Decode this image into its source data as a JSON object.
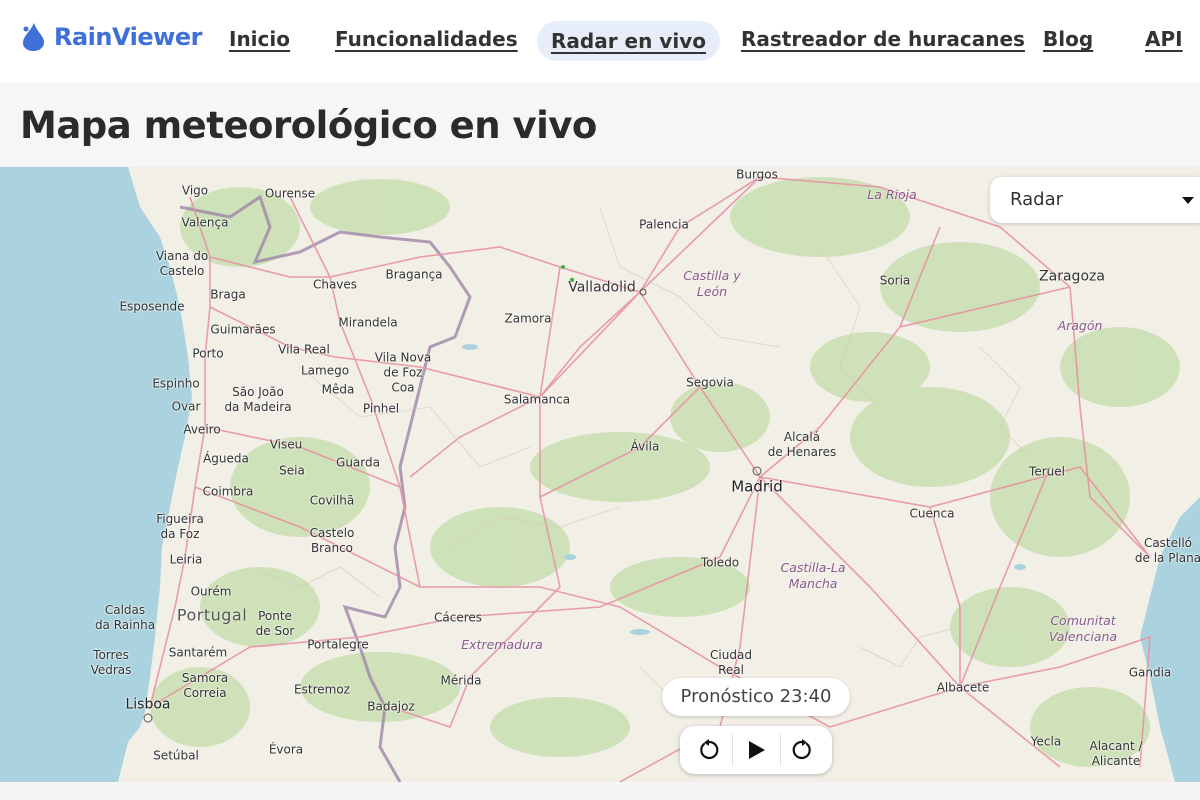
{
  "brand": {
    "name": "RainViewer",
    "color": "#3f6fd8"
  },
  "nav": {
    "items": [
      {
        "label": "Inicio"
      },
      {
        "label": "Funcionalidades"
      },
      {
        "label": "Radar en vivo",
        "active": true
      },
      {
        "label": "Rastreador de huracanes"
      },
      {
        "label": "Blog"
      },
      {
        "label": "API"
      }
    ]
  },
  "page": {
    "title": "Mapa meteorológico en vivo"
  },
  "map": {
    "layer_select": {
      "selected": "Radar"
    },
    "forecast_label": "Pronóstico 23:40",
    "controls": {
      "back_icon": "rewind-icon",
      "play_icon": "play-icon",
      "forward_icon": "forward-icon"
    },
    "places": {
      "vigo": "Vigo",
      "ourense": "Ourense",
      "valenca": "Valença",
      "viana": "Viana do\nCastelo",
      "chaves": "Chaves",
      "braganca": "Bragança",
      "braga": "Braga",
      "esposende": "Esposende",
      "guimaraes": "Guimarães",
      "mirandela": "Mirandela",
      "porto": "Porto",
      "vila_real": "Vila Real",
      "lamego": "Lamego",
      "vila_nova": "Vila Nova\nde Foz\nCoa",
      "espinho": "Espinho",
      "sao_joao": "São João\nda Madeira",
      "meda": "Mêda",
      "ovar": "Ovar",
      "pinhel": "Pinhel",
      "aveiro": "Aveiro",
      "viseu": "Viseu",
      "agueda": "Águeda",
      "seia": "Seia",
      "guarda": "Guarda",
      "coimbra": "Coimbra",
      "covilha": "Covilhã",
      "figueira": "Figueira\nda Foz",
      "castelo_branco": "Castelo\nBranco",
      "leiria": "Leiria",
      "ourem": "Ourém",
      "caldas": "Caldas\nda Rainha",
      "ponte_sor": "Ponte\nde Sor",
      "santarem": "Santarém",
      "portalegre": "Portalegre",
      "torres": "Torres\nVedras",
      "samora": "Samora\nCorreia",
      "estremoz": "Estremoz",
      "lisboa": "Lisboa",
      "badajoz": "Badajoz",
      "evora": "Évora",
      "setubal": "Setúbal",
      "burgos": "Burgos",
      "palencia": "Palencia",
      "valladolid": "Valladolid",
      "zamora": "Zamora",
      "segovia": "Segovia",
      "salamanca": "Salamanca",
      "avila": "Ávila",
      "alcala": "Alcalá\nde Henares",
      "madrid": "Madrid",
      "toledo": "Toledo",
      "caceres": "Cáceres",
      "merida": "Mérida",
      "ciudad_real": "Ciudad\nReal",
      "cuenca": "Cuenca",
      "soria": "Soria",
      "zaragoza": "Zaragoza",
      "teruel": "Teruel",
      "castello": "Castelló\nde la Plana",
      "albacete": "Albacete",
      "gandia": "Gandia",
      "yecla": "Yecla",
      "alicante": "Alacant /\nAlicante"
    },
    "regions": {
      "la_rioja": "La Rioja",
      "castilla_leon": "Castilla y\nLeón",
      "aragon": "Aragón",
      "castilla_mancha": "Castilla-La\nMancha",
      "extremadura": "Extremadura",
      "comunitat": "Comunitat\nValenciana"
    },
    "countries": {
      "portugal": "Portugal"
    },
    "colors": {
      "land": "#f2efe7",
      "sea": "#aad3df",
      "forest": "#c8dfb0",
      "roads": "#e892a2",
      "border": "#9e86a8"
    }
  }
}
